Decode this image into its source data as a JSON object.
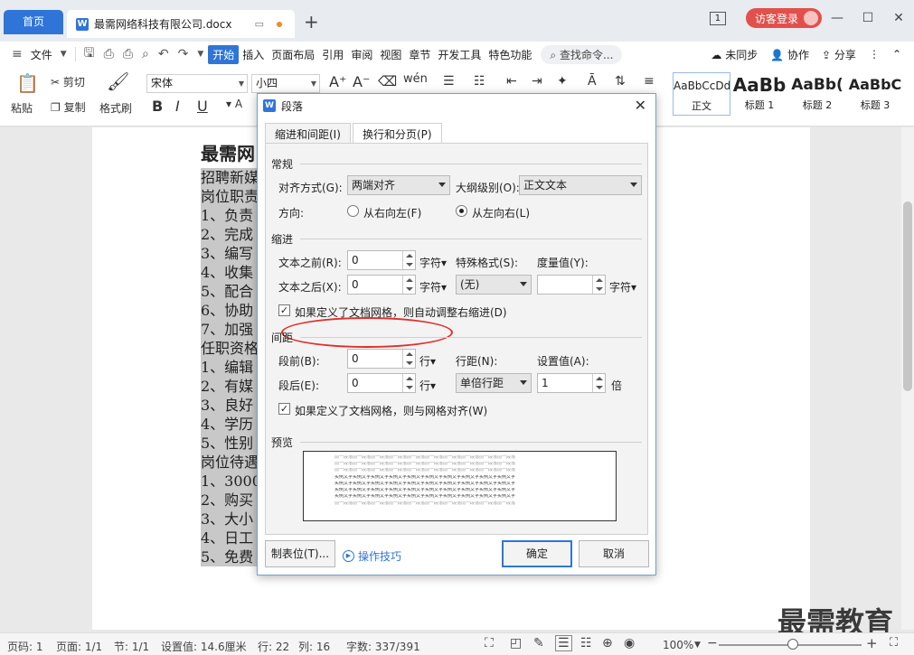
{
  "tabs": {
    "home": "首页",
    "doc": "最需网络科技有限公司.docx",
    "add": "+"
  },
  "titlebar": {
    "badge": "1",
    "guest_login": "访客登录",
    "minimize": "—",
    "maximize": "☐",
    "close": "✕"
  },
  "menu": {
    "file": "文件",
    "items": [
      "开始",
      "插入",
      "页面布局",
      "引用",
      "审阅",
      "视图",
      "章节",
      "开发工具",
      "特色功能"
    ],
    "search": "查找命令...",
    "unsynced": "未同步",
    "collab": "协作",
    "share": "分享"
  },
  "ribbon": {
    "paste": "粘贴",
    "cut": "剪切",
    "copy": "复制",
    "format_painter": "格式刷",
    "font": "宋体",
    "size": "小四",
    "styles": [
      {
        "preview": "AaBbCcDd",
        "label": "正文"
      },
      {
        "preview": "AaBb",
        "label": "标题 1"
      },
      {
        "preview": "AaBb(",
        "label": "标题 2"
      },
      {
        "preview": "AaBbC",
        "label": "标题 3"
      }
    ]
  },
  "document": {
    "title": "最需网",
    "lines": [
      "招聘新媒",
      "岗位职责",
      "1、负责",
      "2、完成",
      "3、编写",
      "4、收集",
      "5、配合",
      "6、协助",
      "7、加强",
      "任职资格",
      "1、编辑",
      "2、有媒",
      "3、良好",
      "4、学历",
      "5、性别",
      "岗位待遇",
      "1、3000",
      "2、购买",
      "3、大小",
      "4、日工",
      "5、免费"
    ]
  },
  "dialog": {
    "title": "段落",
    "tab_indent": "缩进和间距(I)",
    "tab_break": "换行和分页(P)",
    "general": "常规",
    "align_label": "对齐方式(G):",
    "align_value": "两端对齐",
    "outline_label": "大纲级别(O):",
    "outline_value": "正文文本",
    "direction_label": "方向:",
    "rtl": "从右向左(F)",
    "ltr": "从左向右(L)",
    "indent": "缩进",
    "before_text_label": "文本之前(R):",
    "before_text_value": "0",
    "unit_char": "字符▾",
    "special_label": "特殊格式(S):",
    "special_value": "(无)",
    "measure_label": "度量值(Y):",
    "measure_value": "",
    "after_text_label": "文本之后(X):",
    "after_text_value": "0",
    "auto_adjust": "如果定义了文档网格，则自动调整右缩进(D)",
    "spacing": "间距",
    "before_label": "段前(B):",
    "before_value": "0",
    "unit_line": "行▾",
    "line_spacing_label": "行距(N):",
    "line_spacing_value": "单倍行距",
    "setting_label": "设置值(A):",
    "setting_value": "1",
    "times": "倍",
    "after_label": "段后(E):",
    "after_value": "0",
    "snap_grid": "如果定义了文档网格，则与网格对齐(W)",
    "preview": "预览",
    "preview_prev": "前一段落前一段落前一段落前一段落前一段落前一段落前一段落前一段落前一段落前一段落",
    "preview_sample": "实例文字实例文字实例文字实例文字实例文字实例文字实例文字实例文字实例文字实例文字",
    "tabs_button": "制表位(T)...",
    "tips": "操作技巧",
    "ok": "确定",
    "cancel": "取消"
  },
  "status": {
    "page_no": "页码: 1",
    "pages": "页面: 1/1",
    "section": "节: 1/1",
    "setting": "设置值: 14.6厘米",
    "row": "行: 22",
    "col": "列: 16",
    "words": "字数: 337/391",
    "zoom": "100%"
  },
  "watermark": "最需教育"
}
